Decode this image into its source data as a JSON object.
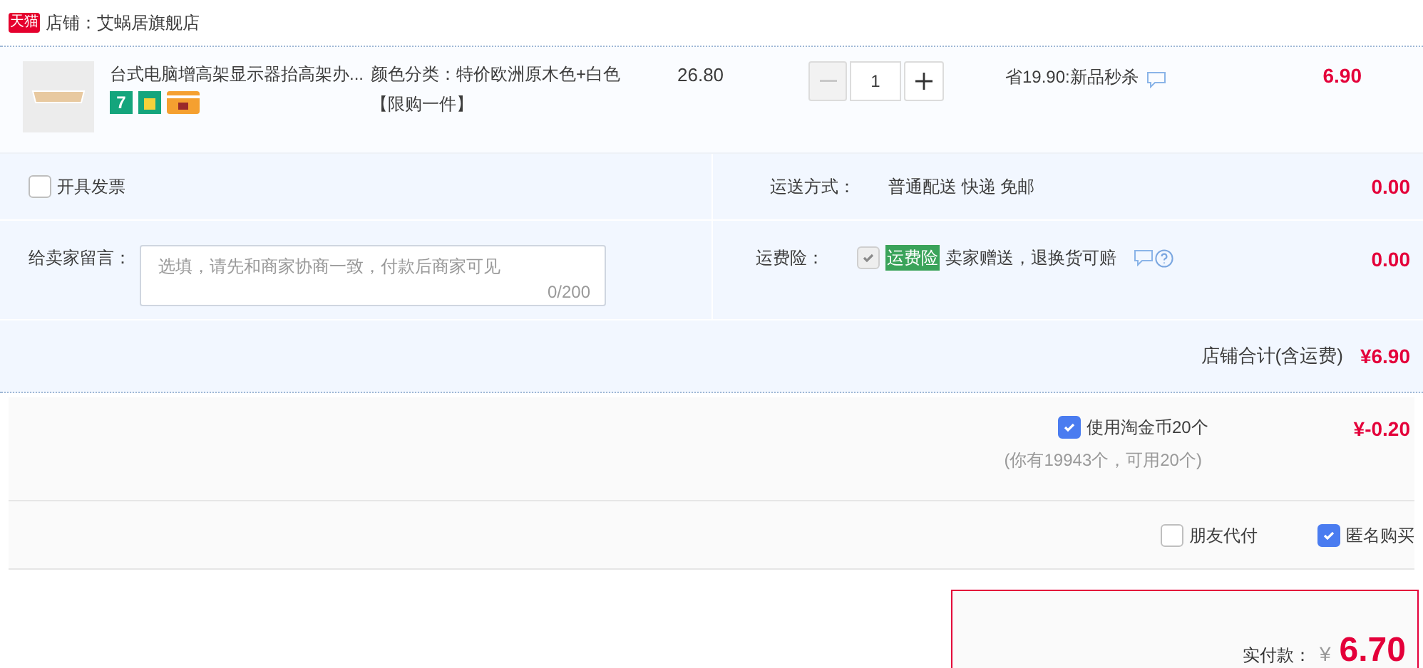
{
  "shop": {
    "badge": "天猫",
    "name": "店铺：艾蜗居旗舰店"
  },
  "item": {
    "title": "台式电脑增高架显示器抬高架办...",
    "sku": "颜色分类：特价欧洲原木色+白色",
    "limit": "【限购一件】",
    "unit_price": "26.80",
    "quantity": "1",
    "minus_disabled": true,
    "return_badge": "7",
    "discount": "省19.90:新品秒杀",
    "subtotal": "6.90"
  },
  "invoice": {
    "label": "开具发票",
    "checked": false
  },
  "shipping": {
    "label": "运送方式：",
    "value": "普通配送 快递 免邮",
    "fee": "0.00"
  },
  "message": {
    "label": "给卖家留言：",
    "placeholder": "选填，请先和商家协商一致，付款后商家可见",
    "counter": "0/200"
  },
  "insurance": {
    "label": "运费险：",
    "checked": true,
    "disabled": true,
    "tag": "运费险",
    "text": "卖家赠送，退换货可赔",
    "fee": "0.00"
  },
  "store_total": {
    "label": "店铺合计(含运费)",
    "value": "¥6.90"
  },
  "coins": {
    "label": "使用淘金币20个",
    "checked": true,
    "note": "(你有19943个，可用20个)",
    "value": "¥-0.20"
  },
  "options": [
    {
      "label": "朋友代付",
      "checked": false
    },
    {
      "label": "匿名购买",
      "checked": true
    }
  ],
  "payment": {
    "label": "实付款：",
    "currency": "¥",
    "value": "6.70"
  }
}
